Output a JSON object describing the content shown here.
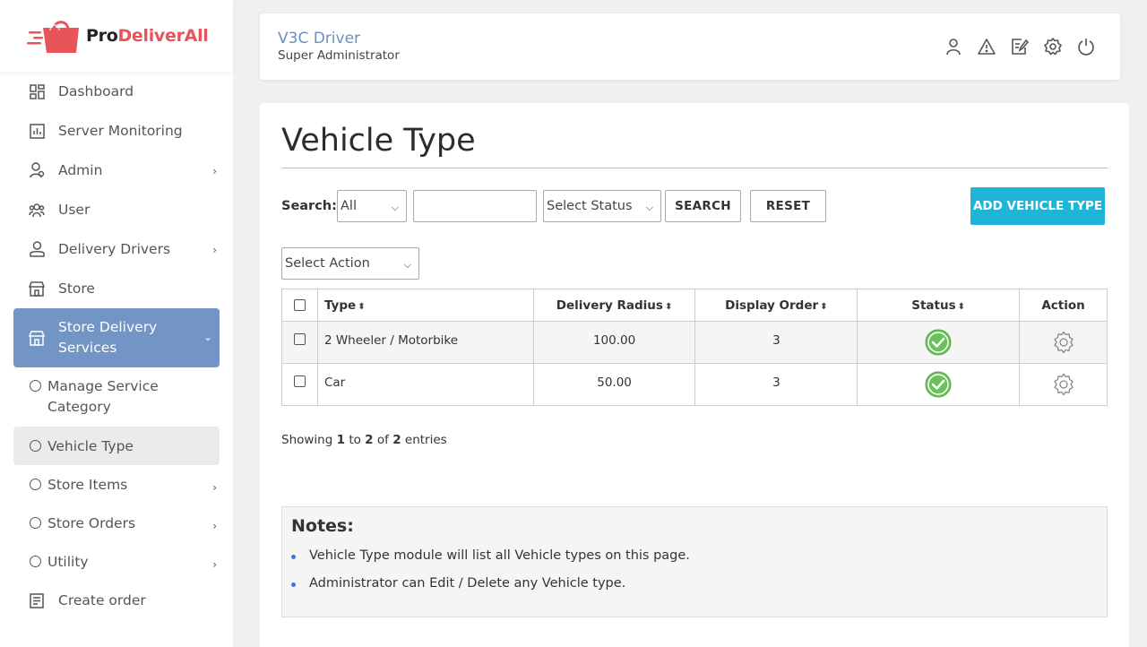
{
  "brand": {
    "name_part1": "Pro",
    "name_part2": "DeliverAll",
    "accent": "#e8545a"
  },
  "sidebar": {
    "items": [
      {
        "label": "Dashboard",
        "icon": "dashboard-icon"
      },
      {
        "label": "Server Monitoring",
        "icon": "chart-icon"
      },
      {
        "label": "Admin",
        "icon": "admin-icon",
        "has_children": true
      },
      {
        "label": "User",
        "icon": "users-icon"
      },
      {
        "label": "Delivery Drivers",
        "icon": "driver-icon",
        "has_children": true
      },
      {
        "label": "Store",
        "icon": "store-icon"
      },
      {
        "label": "Store Delivery Services",
        "icon": "store-icon",
        "expanded": true
      },
      {
        "label": "Create order",
        "icon": "document-icon"
      }
    ],
    "sub_items": [
      {
        "label": "Manage Service Category"
      },
      {
        "label": "Vehicle Type",
        "selected": true
      },
      {
        "label": "Store Items",
        "has_children": true
      },
      {
        "label": "Store Orders",
        "has_children": true
      },
      {
        "label": "Utility",
        "has_children": true
      }
    ]
  },
  "header": {
    "user_name": "V3C Driver",
    "user_role": "Super Administrator",
    "icons": [
      "user-icon",
      "warning-icon",
      "edit-icon",
      "settings-icon",
      "power-icon"
    ]
  },
  "main": {
    "title": "Vehicle Type",
    "search_label": "Search:",
    "search_field_value": "All",
    "search_input_value": "",
    "status_select_value": "Select Status",
    "search_button": "SEARCH",
    "reset_button": "RESET",
    "add_button": "ADD VEHICLE TYPE",
    "action_select_value": "Select Action",
    "table": {
      "headers": [
        "Type",
        "Delivery Radius",
        "Display Order",
        "Status",
        "Action"
      ],
      "rows": [
        {
          "type": "2 Wheeler / Motorbike",
          "radius": "100.00",
          "order": "3",
          "status": "active"
        },
        {
          "type": "Car",
          "radius": "50.00",
          "order": "3",
          "status": "active"
        }
      ]
    },
    "showing": {
      "prefix": "Showing",
      "from": "1",
      "to_word": "to",
      "to": "2",
      "of_word": "of",
      "total": "2",
      "suffix": "entries"
    },
    "notes": {
      "title": "Notes:",
      "items": [
        "Vehicle Type module will list all Vehicle types on this page.",
        "Administrator can Edit / Delete any Vehicle type."
      ]
    }
  },
  "colors": {
    "sidebar_active": "#7395c5",
    "add_button": "#1fb5d6",
    "status_green": "#6ac259"
  }
}
